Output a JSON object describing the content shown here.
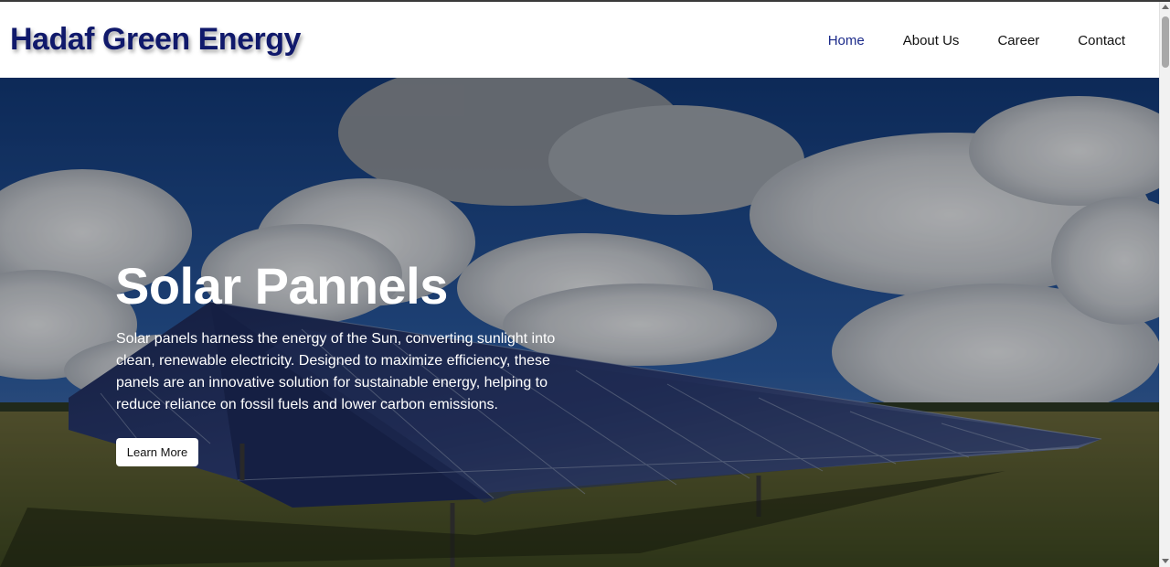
{
  "header": {
    "brand": "Hadaf Green Energy",
    "nav": [
      {
        "label": "Home",
        "active": true
      },
      {
        "label": "About Us",
        "active": false
      },
      {
        "label": "Career",
        "active": false
      },
      {
        "label": "Contact",
        "active": false
      }
    ]
  },
  "hero": {
    "title": "Solar Pannels",
    "description": "Solar panels harness the energy of the Sun, converting sunlight into clean, renewable electricity. Designed to maximize efficiency, these panels are an innovative solution for sustainable energy, helping to reduce reliance on fossil fuels and lower carbon emissions.",
    "button_label": "Learn More",
    "background_image": "solar-panel-field-photo"
  },
  "colors": {
    "brand": "#10196b",
    "nav_active": "#1b2a8a",
    "nav_text": "#111111",
    "hero_text": "#ffffff",
    "button_bg": "#ffffff"
  }
}
